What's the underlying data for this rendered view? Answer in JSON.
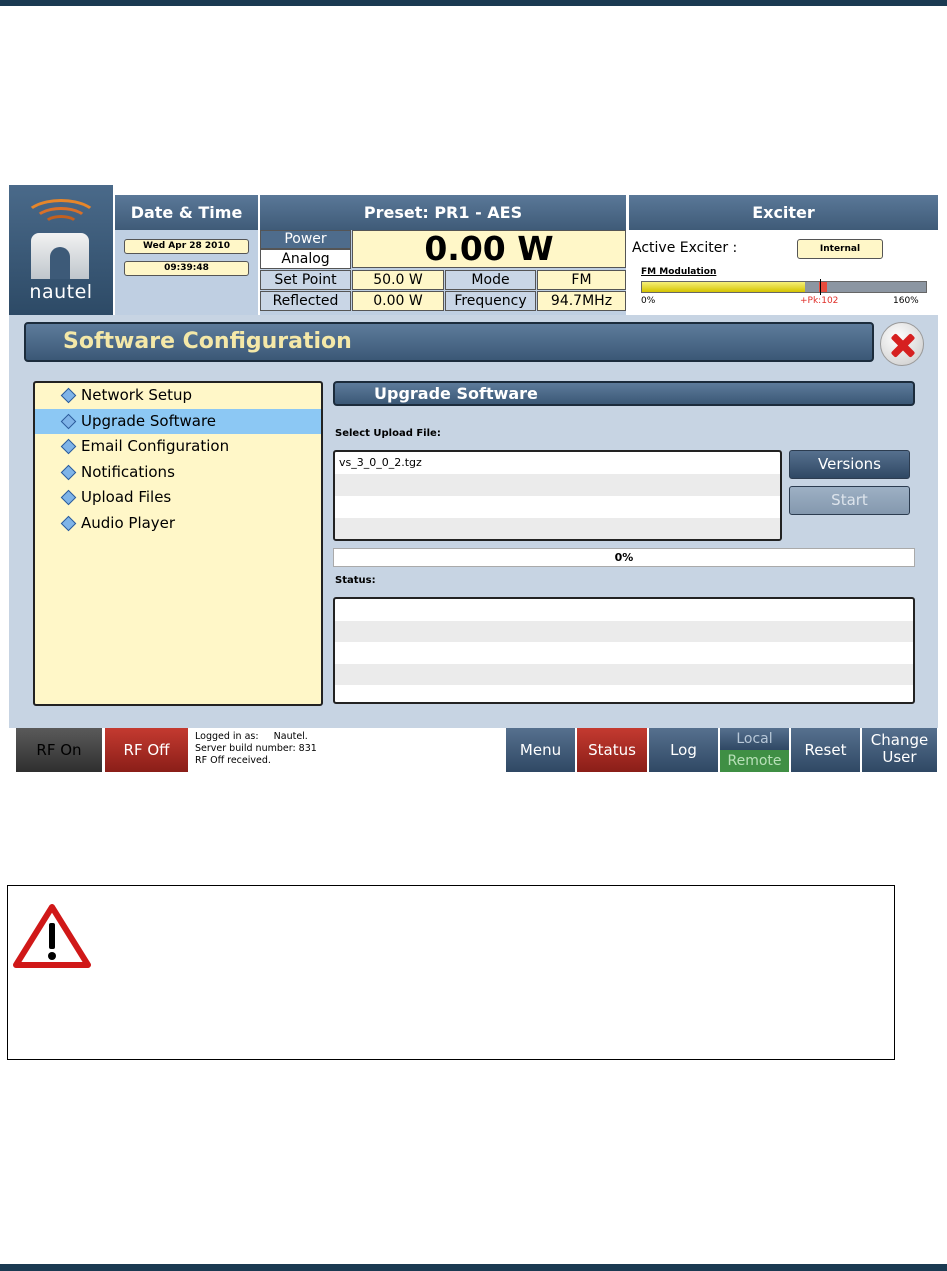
{
  "logo": {
    "name": "nautel"
  },
  "datetime": {
    "title": "Date & Time",
    "date": "Wed Apr 28 2010",
    "time": "09:39:48"
  },
  "preset": {
    "title": "Preset: PR1 - AES",
    "power_label": "Power",
    "analog_label": "Analog",
    "power_value": "0.00 W",
    "setpoint_label": "Set Point",
    "setpoint_value": "50.0 W",
    "mode_label": "Mode",
    "mode_value": "FM",
    "reflected_label": "Reflected",
    "reflected_value": "0.00 W",
    "frequency_label": "Frequency",
    "frequency_value": "94.7MHz"
  },
  "exciter": {
    "title": "Exciter",
    "active_label": "Active Exciter :",
    "active_value": "Internal",
    "fm_label": "FM Modulation",
    "fm_fill_percent": 102,
    "scale_min": "0%",
    "scale_peak": "+Pk:102",
    "scale_max": "160%"
  },
  "page": {
    "title": "Software Configuration"
  },
  "menu": {
    "items": [
      {
        "label": "Network Setup",
        "selected": false
      },
      {
        "label": "Upgrade Software",
        "selected": true
      },
      {
        "label": "Email Configuration",
        "selected": false
      },
      {
        "label": "Notifications",
        "selected": false
      },
      {
        "label": "Upload Files",
        "selected": false
      },
      {
        "label": "Audio Player",
        "selected": false
      }
    ]
  },
  "upgrade": {
    "title": "Upgrade Software",
    "select_label": "Select Upload File:",
    "files": [
      "vs_3_0_0_2.tgz",
      "",
      "",
      ""
    ],
    "versions_button": "Versions",
    "start_button": "Start",
    "progress": "0%",
    "status_label": "Status:",
    "status_rows": [
      "",
      "",
      "",
      "",
      ""
    ]
  },
  "footer": {
    "rf_on": "RF On",
    "rf_off": "RF Off",
    "messages": [
      "Logged in as:     Nautel.",
      "Server build number: 831",
      "RF Off received."
    ],
    "menu": "Menu",
    "status": "Status",
    "log": "Log",
    "local": "Local",
    "remote": "Remote",
    "reset": "Reset",
    "change_user_1": "Change",
    "change_user_2": "User"
  },
  "colors": {
    "header_blue": "#3f5b78",
    "panel_yellow": "#fff7c8",
    "selection_blue": "#8cc8f4",
    "rf_off_red": "#c43a30",
    "remote_green": "#3f8f44"
  }
}
